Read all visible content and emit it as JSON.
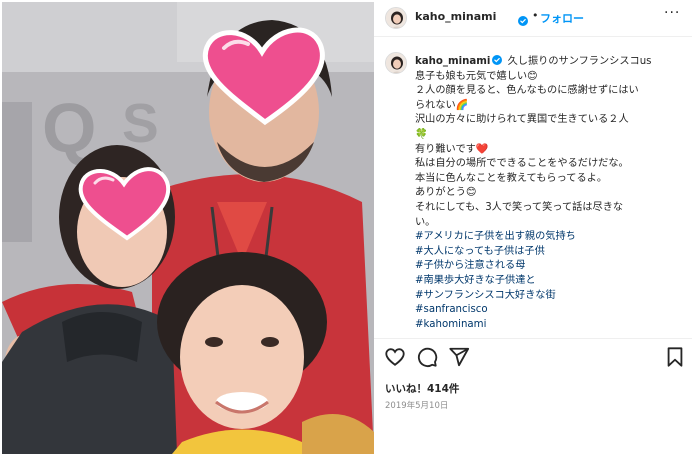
{
  "post": {
    "username": "kaho_minami",
    "follow_label": "フォロー",
    "separator": "•",
    "more_label": "···",
    "caption": {
      "username": "kaho_minami",
      "lines": [
        "久し振りのサンフランシスコus",
        "息子も娘も元気で嬉しい😊",
        "２人の顔を見ると、色んなものに感謝せずにはい",
        "られない🌈",
        "沢山の方々に助けられて異国で生きている２人",
        "🍀",
        "有り難いです❤️",
        "私は自分の場所でできることをやるだけだな。",
        "本当に色んなことを教えてもらってるよ。",
        "ありがとう😊",
        "それにしても、3人で笑って笑って話は尽きな",
        "い。"
      ],
      "hashtags": [
        "#アメリカに子供を出す親の気持ち",
        "#大人になっても子供は子供",
        "#子供から注意される母",
        "#南果歩大好きな子供達と",
        "#サンフランシスコ大好きな街",
        "#sanfrancisco",
        "#kahominami"
      ]
    },
    "likes_text": "いいね！414件",
    "date": "2019年5月10日"
  },
  "icons": {
    "like": "heart-outline-icon",
    "comment": "speech-bubble-icon",
    "share": "paper-plane-icon",
    "save": "bookmark-icon",
    "verified": "verified-badge-icon",
    "more": "ellipsis-icon"
  },
  "colors": {
    "link_blue": "#0095f6",
    "hashtag": "#00376b",
    "verified": "#0095f6",
    "heart_sticker": "#ee4f8f"
  }
}
